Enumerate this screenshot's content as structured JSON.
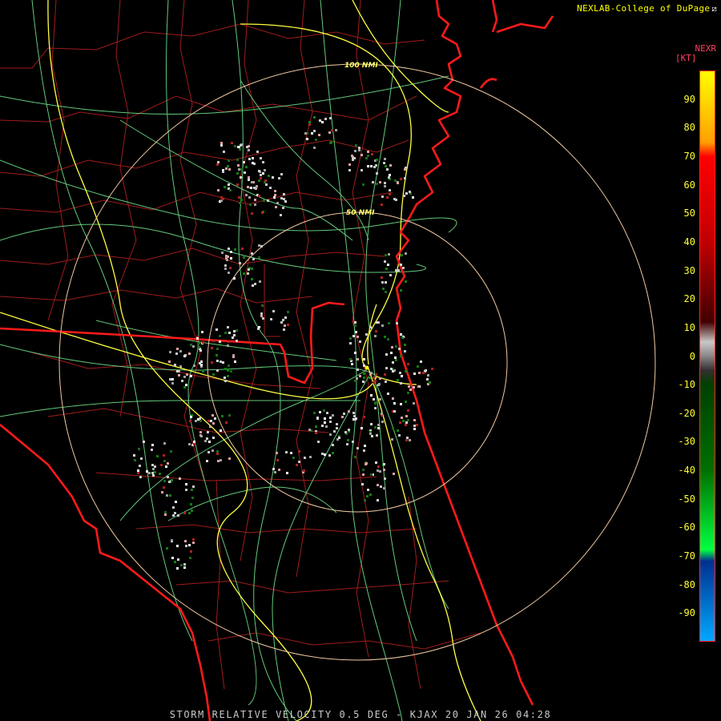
{
  "credit": "NEXLAB-College of DuPage",
  "product": "NEXR",
  "unit": "[KT]",
  "footer": "STORM RELATIVE VELOCITY 0.5 DEG - KJAX 20 JAN 26 04:28",
  "rings": {
    "inner_label": "50 NMI",
    "outer_label": "100 NMI"
  },
  "colorbar": {
    "ticks": [
      {
        "v": 90,
        "label": "90"
      },
      {
        "v": 80,
        "label": "80"
      },
      {
        "v": 70,
        "label": "70"
      },
      {
        "v": 60,
        "label": "60"
      },
      {
        "v": 50,
        "label": "50"
      },
      {
        "v": 40,
        "label": "40"
      },
      {
        "v": 30,
        "label": "30"
      },
      {
        "v": 20,
        "label": "20"
      },
      {
        "v": 10,
        "label": "10"
      },
      {
        "v": 0,
        "label": "0"
      },
      {
        "v": -10,
        "label": "-10"
      },
      {
        "v": -20,
        "label": "-20"
      },
      {
        "v": -30,
        "label": "-30"
      },
      {
        "v": -40,
        "label": "-40"
      },
      {
        "v": -50,
        "label": "-50"
      },
      {
        "v": -60,
        "label": "-60"
      },
      {
        "v": -70,
        "label": "-70"
      },
      {
        "v": -80,
        "label": "-80"
      },
      {
        "v": -90,
        "label": "-90"
      }
    ],
    "range": [
      -100,
      100
    ],
    "stops": [
      {
        "v": 100,
        "color": "#ffff00"
      },
      {
        "v": 75,
        "color": "#ff9f00"
      },
      {
        "v": 70,
        "color": "#ff0000"
      },
      {
        "v": 40,
        "color": "#c00000"
      },
      {
        "v": 12,
        "color": "#400000"
      },
      {
        "v": 5,
        "color": "#c8c8c8"
      },
      {
        "v": 0,
        "color": "#888888"
      },
      {
        "v": -5,
        "color": "#303030"
      },
      {
        "v": -10,
        "color": "#004000"
      },
      {
        "v": -40,
        "color": "#007000"
      },
      {
        "v": -68,
        "color": "#00ff40"
      },
      {
        "v": -72,
        "color": "#003090"
      },
      {
        "v": -100,
        "color": "#00a8ff"
      }
    ]
  },
  "colors": {
    "coast": "#ff1a1a",
    "county": "#b02020",
    "road": "#6ee08a",
    "interstate": "#ffff44",
    "ring": "#f0c8a0"
  }
}
